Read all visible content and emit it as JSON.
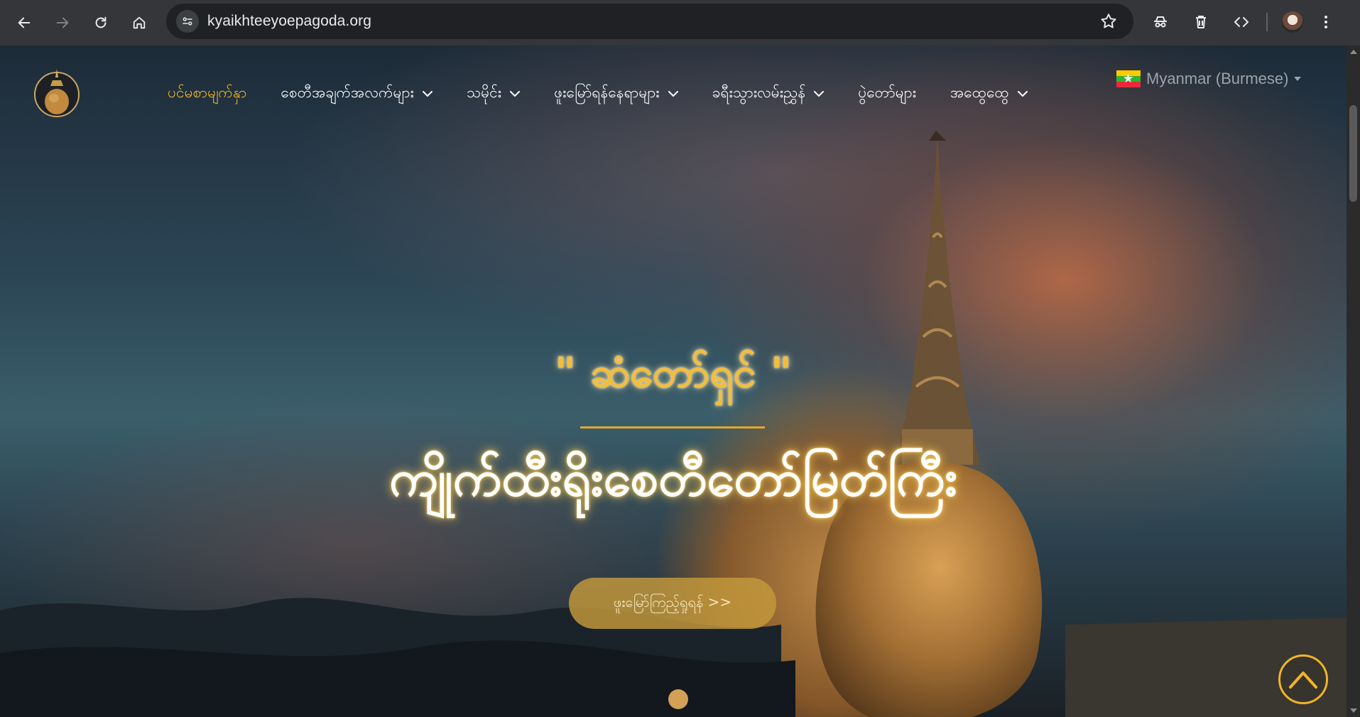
{
  "browser": {
    "url": "kyaikhteeyoepagoda.org",
    "icons": [
      "back-arrow-icon",
      "forward-arrow-icon",
      "reload-icon",
      "home-icon",
      "site-info-icon",
      "bookmark-star-icon",
      "incognito-icon",
      "trash-icon",
      "code-icon",
      "profile-avatar",
      "more-menu-icon"
    ]
  },
  "site": {
    "menu": [
      {
        "label": "ပင်မစာမျက်နှာ",
        "active": true,
        "dropdown": false
      },
      {
        "label": "စေတီအချက်အလက်များ",
        "active": false,
        "dropdown": true
      },
      {
        "label": "သမိုင်း",
        "active": false,
        "dropdown": true
      },
      {
        "label": "ဖူးမြော်ရန်နေရာများ",
        "active": false,
        "dropdown": true
      },
      {
        "label": "ခရီးသွားလမ်းညွှန်",
        "active": false,
        "dropdown": true
      },
      {
        "label": "ပွဲတော်များ",
        "active": false,
        "dropdown": false
      },
      {
        "label": "အထွေထွေ",
        "active": false,
        "dropdown": true
      }
    ],
    "language": "Myanmar (Burmese)"
  },
  "hero": {
    "subtitle": "\" ဆံတော်ရှင် \"",
    "title": "ကျိုက်ထီးရိုးစေတီတော်မြတ်ကြီး",
    "button": "ဖူးမြော်ကြည့်ရှုရန် >>"
  },
  "colors": {
    "accent": "#f0b429",
    "chrome": "#35363a",
    "omnibox": "#202124"
  }
}
